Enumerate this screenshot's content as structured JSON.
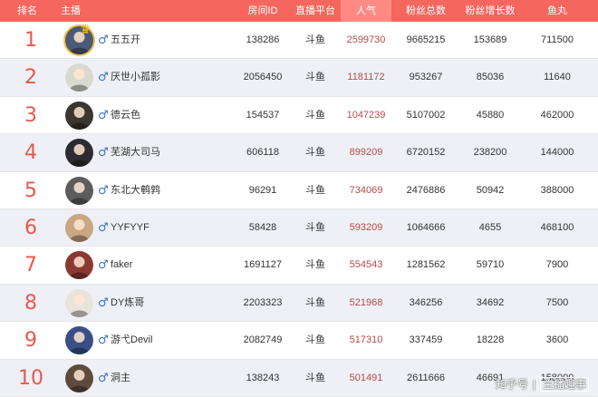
{
  "headers": {
    "rank": "排名",
    "anchor": "主播",
    "room_id": "房间ID",
    "platform": "直播平台",
    "popularity": "人气",
    "fans_total": "粉丝总数",
    "fans_growth": "粉丝增长数",
    "fish_balls": "鱼丸"
  },
  "header_colors": {
    "bar": "#f4665e",
    "active": "#ff8a84"
  },
  "rows": [
    {
      "rank": "1",
      "name": "五五开",
      "room_id": "138286",
      "platform": "斗鱼",
      "popularity": "2599730",
      "fans_total": "9665215",
      "fans_growth": "153689",
      "fish_balls": "711500",
      "gender_icon": "male-icon",
      "avatar_color": "#4c5a78"
    },
    {
      "rank": "2",
      "name": "厌世小孤影",
      "room_id": "2056450",
      "platform": "斗鱼",
      "popularity": "1181172",
      "fans_total": "953267",
      "fans_growth": "85036",
      "fish_balls": "11640",
      "gender_icon": "male-icon",
      "avatar_color": "#d9d9cf"
    },
    {
      "rank": "3",
      "name": "德云色",
      "room_id": "154537",
      "platform": "斗鱼",
      "popularity": "1047239",
      "fans_total": "5107002",
      "fans_growth": "45880",
      "fish_balls": "462000",
      "gender_icon": "male-icon",
      "avatar_color": "#3b3630"
    },
    {
      "rank": "4",
      "name": "芜湖大司马",
      "room_id": "606118",
      "platform": "斗鱼",
      "popularity": "899209",
      "fans_total": "6720152",
      "fans_growth": "238200",
      "fish_balls": "144000",
      "gender_icon": "male-icon",
      "avatar_color": "#2d2b2f"
    },
    {
      "rank": "5",
      "name": "东北大鹌鹑",
      "room_id": "96291",
      "platform": "斗鱼",
      "popularity": "734069",
      "fans_total": "2476886",
      "fans_growth": "50942",
      "fish_balls": "388000",
      "gender_icon": "male-icon",
      "avatar_color": "#5c5c5c"
    },
    {
      "rank": "6",
      "name": "YYFYYF",
      "room_id": "58428",
      "platform": "斗鱼",
      "popularity": "593209",
      "fans_total": "1064666",
      "fans_growth": "4655",
      "fish_balls": "468100",
      "gender_icon": "male-icon",
      "avatar_color": "#c9a783"
    },
    {
      "rank": "7",
      "name": "faker",
      "room_id": "1691127",
      "platform": "斗鱼",
      "popularity": "554543",
      "fans_total": "1281562",
      "fans_growth": "59710",
      "fish_balls": "7900",
      "gender_icon": "male-icon",
      "avatar_color": "#8a3a32"
    },
    {
      "rank": "8",
      "name": "DY炼哥",
      "room_id": "2203323",
      "platform": "斗鱼",
      "popularity": "521968",
      "fans_total": "346256",
      "fans_growth": "34692",
      "fish_balls": "7500",
      "gender_icon": "male-icon",
      "avatar_color": "#e8e4dc"
    },
    {
      "rank": "9",
      "name": "游弋Devil",
      "room_id": "2082749",
      "platform": "斗鱼",
      "popularity": "517310",
      "fans_total": "337459",
      "fans_growth": "18228",
      "fish_balls": "3600",
      "gender_icon": "male-icon",
      "avatar_color": "#3a4f86"
    },
    {
      "rank": "10",
      "name": "洞主",
      "room_id": "138243",
      "platform": "斗鱼",
      "popularity": "501491",
      "fans_total": "2611666",
      "fans_growth": "46691",
      "fish_balls": "158000",
      "gender_icon": "male-icon",
      "avatar_color": "#5f4a3e"
    }
  ],
  "watermark": {
    "left": "知乎号",
    "sep": "|",
    "right": "主播趣事"
  }
}
